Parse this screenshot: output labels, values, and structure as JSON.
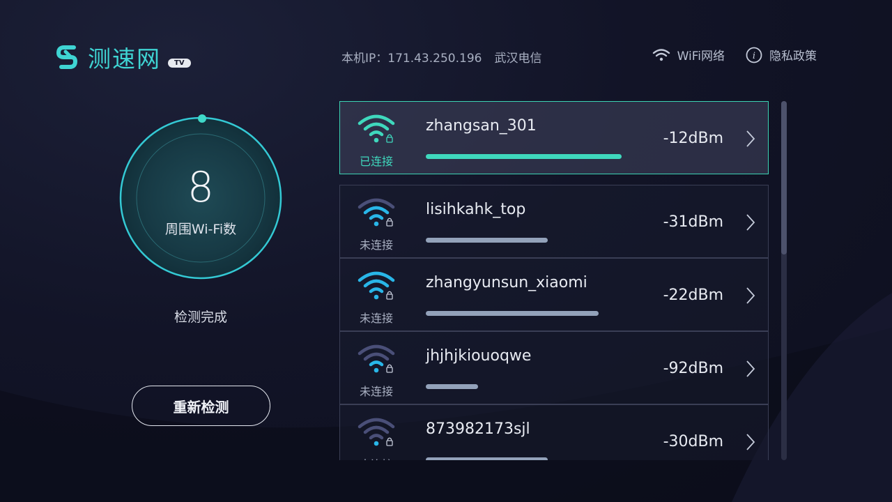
{
  "header": {
    "logo_text": "测速网",
    "logo_badge": "TV",
    "ip_label": "本机IP：171.43.250.196",
    "isp": "武汉电信",
    "wifi_network_label": "WiFi网络",
    "privacy_label": "隐私政策"
  },
  "left_panel": {
    "wifi_count": "8",
    "wifi_count_label": "周围Wi-Fi数",
    "status": "检测完成",
    "redetect_button": "重新检测"
  },
  "wifi_list": [
    {
      "name": "zhangsan_301",
      "signal": "-12dBm",
      "state": "已连接",
      "connected": true,
      "strength": 0.73
    },
    {
      "name": "lisihkahk_top",
      "signal": "-31dBm",
      "state": "未连接",
      "connected": false,
      "strength": 0.45
    },
    {
      "name": "zhangyunsun_xiaomi",
      "signal": "-22dBm",
      "state": "未连接",
      "connected": false,
      "strength": 0.64
    },
    {
      "name": "jhjhjkiouoqwe",
      "signal": "-92dBm",
      "state": "未连接",
      "connected": false,
      "strength": 0.19
    },
    {
      "name": "873982173sjl",
      "signal": "-30dBm",
      "state": "未连接",
      "connected": false,
      "strength": 0.45
    }
  ],
  "colors": {
    "accent": "#3fd4d3",
    "connected": "#3fd8bd",
    "wifi_active_arc": "#29b6e8",
    "wifi_inactive_arc": "#4a4f78"
  },
  "icons": {
    "logo": "speedtest-logo-icon",
    "wifi": "wifi-icon",
    "info": "info-icon",
    "lock": "lock-icon",
    "chevron": "chevron-right-icon"
  }
}
